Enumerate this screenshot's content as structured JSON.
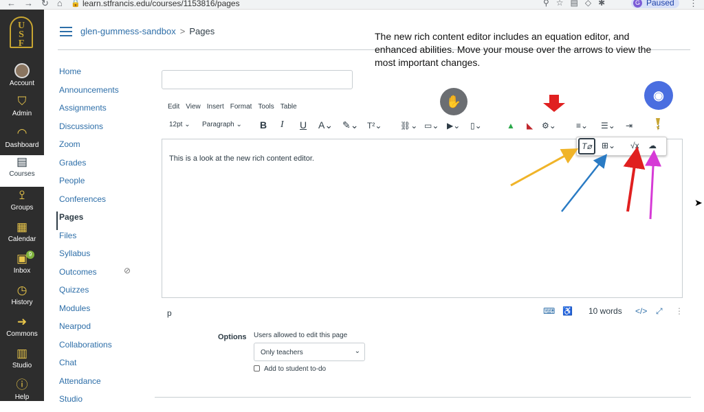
{
  "browser": {
    "url": "learn.stfrancis.edu/courses/1153816/pages",
    "profile_initial": "G",
    "profile_status": "Paused"
  },
  "global_nav": {
    "logo_text": "USF",
    "items": [
      {
        "label": "Account",
        "icon": "user-avatar-icon"
      },
      {
        "label": "Admin",
        "icon": "shield-icon"
      },
      {
        "label": "Dashboard",
        "icon": "dashboard-icon"
      },
      {
        "label": "Courses",
        "icon": "book-icon"
      },
      {
        "label": "Groups",
        "icon": "groups-icon"
      },
      {
        "label": "Calendar",
        "icon": "calendar-icon"
      },
      {
        "label": "Inbox",
        "icon": "inbox-icon",
        "badge": "9"
      },
      {
        "label": "History",
        "icon": "clock-icon"
      },
      {
        "label": "Commons",
        "icon": "commons-icon"
      },
      {
        "label": "Studio",
        "icon": "studio-icon"
      },
      {
        "label": "Help",
        "icon": "help-icon"
      }
    ]
  },
  "breadcrumb": {
    "course": "glen-gummess-sandbox",
    "separator": ">",
    "current": "Pages"
  },
  "annotation_note": "The new rich content editor includes an equation editor, and enhanced abilities.  Move your mouse over the arrows to view the most important changes.",
  "course_nav": [
    "Home",
    "Announcements",
    "Assignments",
    "Discussions",
    "Zoom",
    "Grades",
    "People",
    "Conferences",
    "Pages",
    "Files",
    "Syllabus",
    "Outcomes",
    "Quizzes",
    "Modules",
    "Nearpod",
    "Collaborations",
    "Chat",
    "Attendance",
    "Studio"
  ],
  "editor": {
    "menus": [
      "Edit",
      "View",
      "Insert",
      "Format",
      "Tools",
      "Table"
    ],
    "font_size": "12pt",
    "block_format": "Paragraph",
    "content": "This is a look at the new rich content editor.",
    "path": "p",
    "word_count": "10 words",
    "html_toggle": "</>"
  },
  "options": {
    "label": "Options",
    "edit_permission_label": "Users allowed to edit this page",
    "edit_permission_value": "Only teachers",
    "todo_label": "Add to student to-do"
  },
  "colors": {
    "link": "#2d6ea8",
    "nav_bg": "#2d2d2d",
    "accent_gold": "#e8c54a",
    "arrow_yellow": "#f0b429",
    "arrow_blue": "#2a7bc4",
    "arrow_red": "#e02020",
    "arrow_pink": "#d63ad6",
    "eye_circle": "#4a6ee0"
  }
}
